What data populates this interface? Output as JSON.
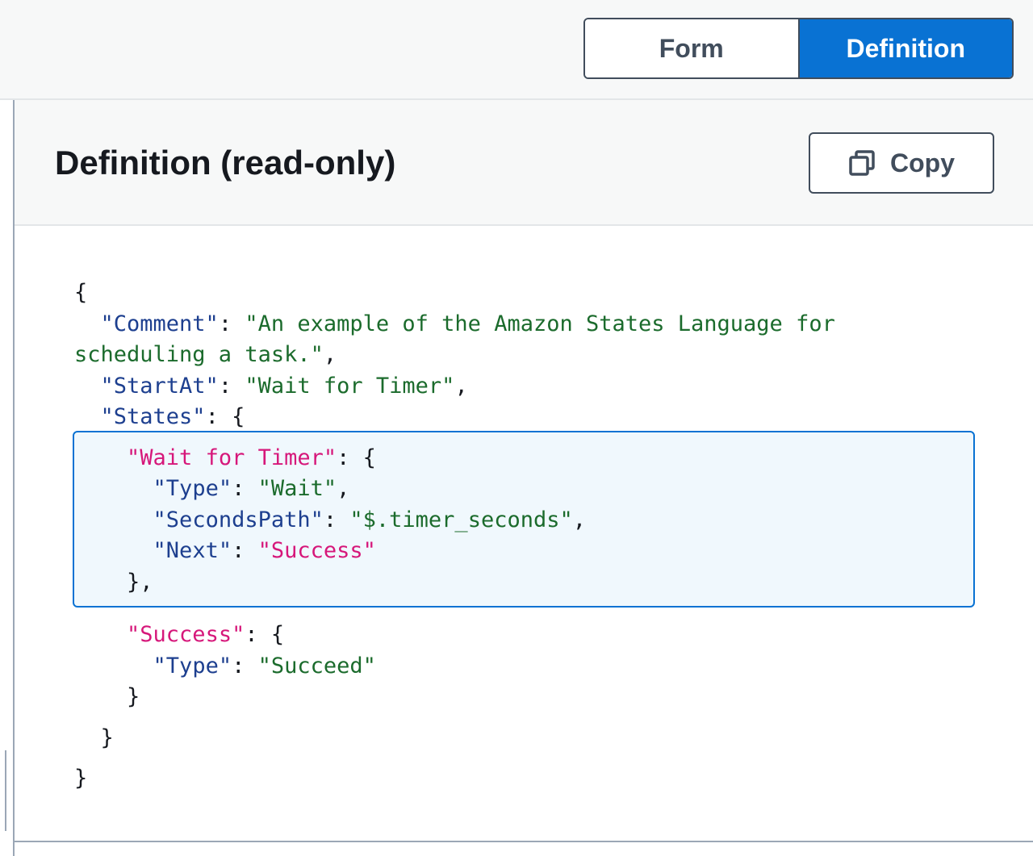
{
  "view_toggle": {
    "form_label": "Form",
    "definition_label": "Definition",
    "selected": "Definition"
  },
  "panel": {
    "title": "Definition (read-only)",
    "copy_label": "Copy",
    "copy_icon": "copy-icon"
  },
  "code": {
    "lines": [
      [
        {
          "t": "p",
          "v": "{"
        }
      ],
      [
        {
          "t": "p",
          "v": "  "
        },
        {
          "t": "k",
          "v": "\"Comment\""
        },
        {
          "t": "p",
          "v": ": "
        },
        {
          "t": "s",
          "v": "\"An example of the Amazon States Language for"
        }
      ],
      [
        {
          "t": "s",
          "v": "scheduling a task.\""
        },
        {
          "t": "p",
          "v": ","
        }
      ],
      [
        {
          "t": "p",
          "v": "  "
        },
        {
          "t": "k",
          "v": "\"StartAt\""
        },
        {
          "t": "p",
          "v": ": "
        },
        {
          "t": "s",
          "v": "\"Wait for Timer\""
        },
        {
          "t": "p",
          "v": ","
        }
      ],
      [
        {
          "t": "p",
          "v": "  "
        },
        {
          "t": "k",
          "v": "\"States\""
        },
        {
          "t": "p",
          "v": ": {"
        }
      ],
      [
        {
          "t": "p",
          "v": "    "
        },
        {
          "t": "pk",
          "v": "\"Wait for Timer\""
        },
        {
          "t": "p",
          "v": ": {"
        }
      ],
      [
        {
          "t": "p",
          "v": "      "
        },
        {
          "t": "k",
          "v": "\"Type\""
        },
        {
          "t": "p",
          "v": ": "
        },
        {
          "t": "s",
          "v": "\"Wait\""
        },
        {
          "t": "p",
          "v": ","
        }
      ],
      [
        {
          "t": "p",
          "v": "      "
        },
        {
          "t": "k",
          "v": "\"SecondsPath\""
        },
        {
          "t": "p",
          "v": ": "
        },
        {
          "t": "s",
          "v": "\"$.timer_seconds\""
        },
        {
          "t": "p",
          "v": ","
        }
      ],
      [
        {
          "t": "p",
          "v": "      "
        },
        {
          "t": "k",
          "v": "\"Next\""
        },
        {
          "t": "p",
          "v": ": "
        },
        {
          "t": "pk",
          "v": "\"Success\""
        }
      ],
      [
        {
          "t": "p",
          "v": "    },"
        }
      ],
      [
        {
          "t": "p",
          "v": "    "
        },
        {
          "t": "pk",
          "v": "\"Success\""
        },
        {
          "t": "p",
          "v": ": {"
        }
      ],
      [
        {
          "t": "p",
          "v": "      "
        },
        {
          "t": "k",
          "v": "\"Type\""
        },
        {
          "t": "p",
          "v": ": "
        },
        {
          "t": "s",
          "v": "\"Succeed\""
        }
      ],
      [
        {
          "t": "p",
          "v": "    }"
        }
      ],
      [
        {
          "t": "p",
          "v": "  }"
        }
      ],
      [
        {
          "t": "p",
          "v": "}"
        }
      ]
    ]
  }
}
